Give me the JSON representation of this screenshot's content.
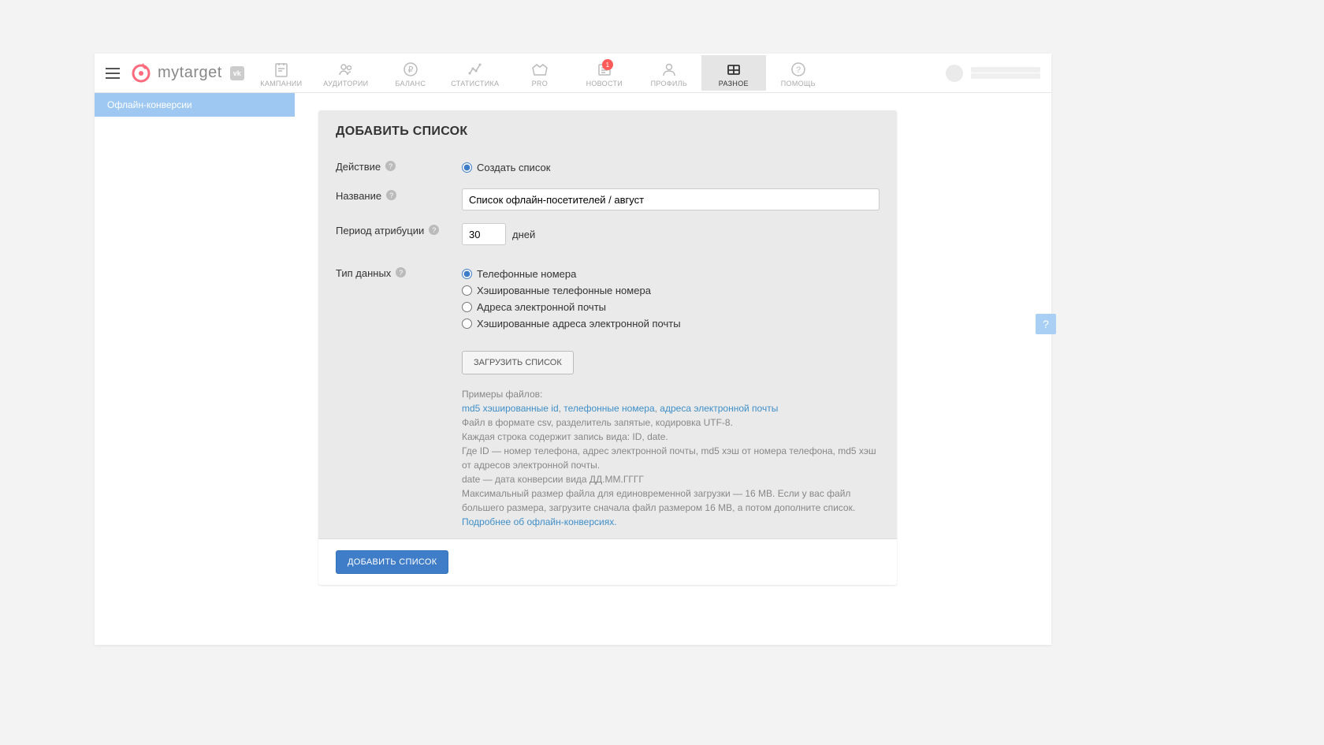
{
  "logo": {
    "text": "mytarget"
  },
  "nav": {
    "items": [
      {
        "label": "КАМПАНИИ"
      },
      {
        "label": "АУДИТОРИИ"
      },
      {
        "label": "БАЛАНС"
      },
      {
        "label": "СТАТИСТИКА"
      },
      {
        "label": "PRO"
      },
      {
        "label": "НОВОСТИ",
        "badge": "1"
      },
      {
        "label": "ПРОФИЛЬ"
      },
      {
        "label": "РАЗНОЕ"
      },
      {
        "label": "ПОМОЩЬ"
      }
    ]
  },
  "sidenav": {
    "item0": "Офлайн-конверсии"
  },
  "panel": {
    "title": "ДОБАВИТЬ СПИСОК",
    "action": {
      "label": "Действие",
      "option_create": "Создать список"
    },
    "name": {
      "label": "Название",
      "value": "Список офлайн-посетителей / август"
    },
    "attrib": {
      "label": "Период атрибуции",
      "value": "30",
      "unit": "дней"
    },
    "data_type": {
      "label": "Тип данных",
      "opt1": "Телефонные номера",
      "opt2": "Хэшированные телефонные номера",
      "opt3": "Адреса электронной почты",
      "opt4": "Хэшированные адреса электронной почты"
    },
    "upload_btn": "ЗАГРУЗИТЬ СПИСОК",
    "hint": {
      "examples": "Примеры файлов:",
      "link_md5": "md5 хэшированные id",
      "sep1": ", ",
      "link_phone": "телефонные номера",
      "sep2": ", ",
      "link_email": "адреса электронной почты",
      "line1": "Файл в формате csv, разделитель запятые, кодировка UTF-8.",
      "line2": "Каждая строка содержит запись вида: ID, date.",
      "line3": "Где ID — номер телефона, адрес электронной почты, md5 хэш от номера телефона, md5 хэш от адресов электронной почты.",
      "line4": "date — дата конверсии вида ДД.ММ.ГГГГ",
      "line5": "Максимальный размер файла для единовременной загрузки — 16 MB. Если у вас файл большего размера, загрузите сначала файл размером 16 MB, а потом дополните список.",
      "more_link": "Подробнее об офлайн-конверсиях."
    },
    "submit": "ДОБАВИТЬ СПИСОК"
  },
  "floating_help": "?"
}
